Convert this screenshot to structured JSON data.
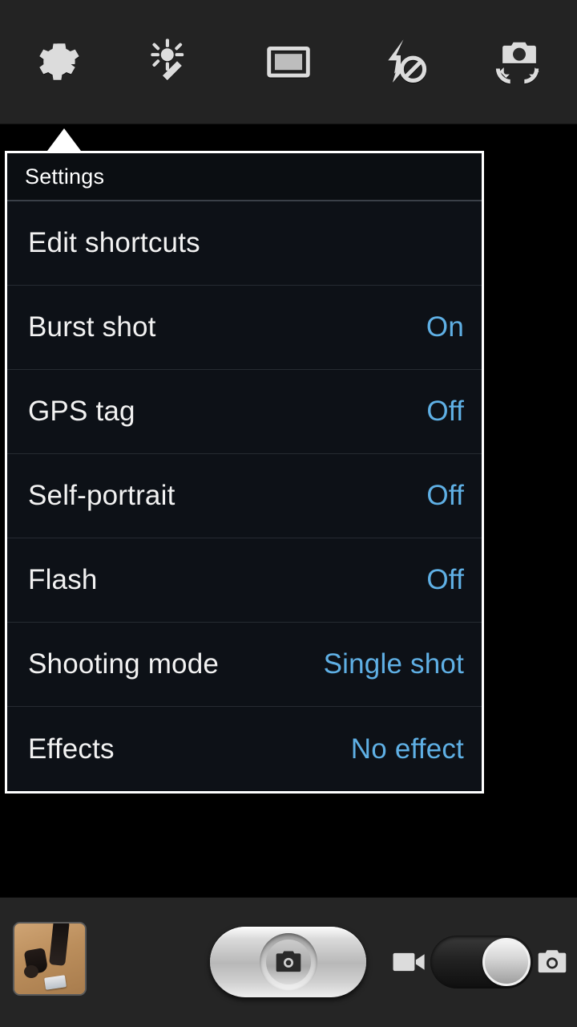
{
  "app": {
    "name": "Camera",
    "accent_blue": "#5fb0e5",
    "topbar_bg": "#232323",
    "popup_bg": "#0d1117",
    "popup_border": "#ffffff"
  },
  "topbar": {
    "icons": [
      {
        "name": "settings-gear-icon",
        "label": "Settings"
      },
      {
        "name": "magic-wand-icon",
        "label": "Effects"
      },
      {
        "name": "frame-mode-icon",
        "label": "Shooting mode"
      },
      {
        "name": "flash-off-icon",
        "label": "Flash off"
      },
      {
        "name": "switch-camera-icon",
        "label": "Switch camera"
      }
    ]
  },
  "settings_popup": {
    "title": "Settings",
    "items": [
      {
        "label": "Edit shortcuts",
        "value": ""
      },
      {
        "label": "Burst shot",
        "value": "On"
      },
      {
        "label": "GPS tag",
        "value": "Off"
      },
      {
        "label": "Self-portrait",
        "value": "Off"
      },
      {
        "label": "Flash",
        "value": "Off"
      },
      {
        "label": "Shooting mode",
        "value": "Single shot"
      },
      {
        "label": "Effects",
        "value": "No effect"
      }
    ]
  },
  "bottombar": {
    "thumbnail": {
      "name": "last-photo-thumbnail",
      "label": "Last photo"
    },
    "shutter": {
      "name": "shutter-button",
      "label": "Take photo"
    },
    "mode_switch": {
      "video_icon": "video-camera-icon",
      "photo_icon": "photo-camera-icon",
      "selected": "photo"
    }
  }
}
